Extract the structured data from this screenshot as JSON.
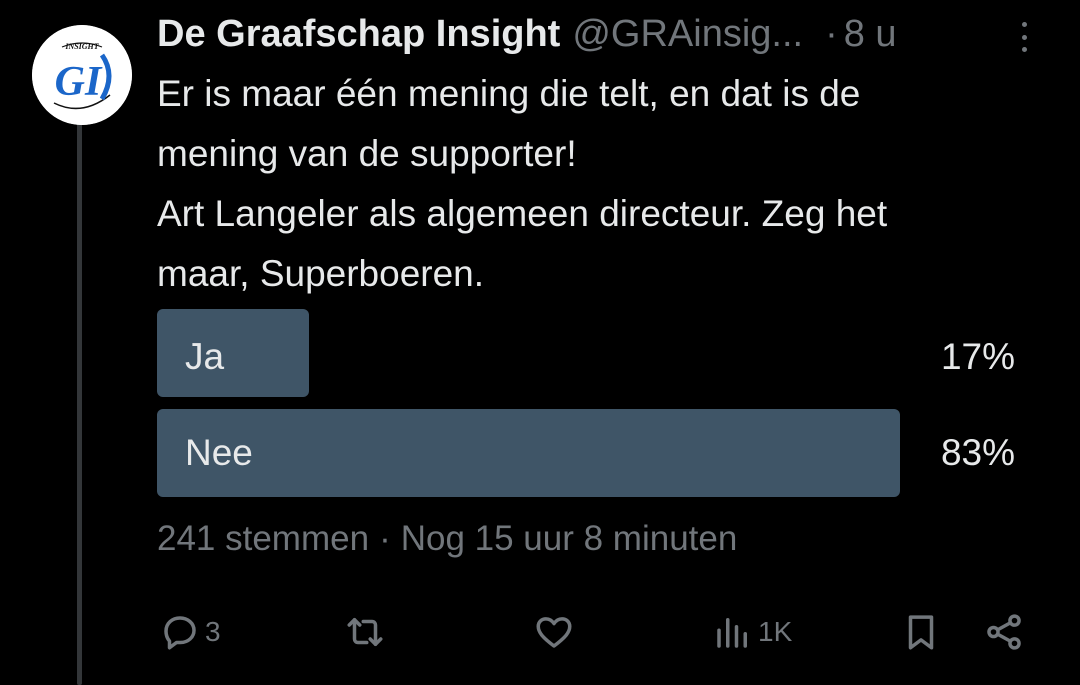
{
  "author": {
    "display_name": "De Graafschap Insight",
    "handle": "@GRAinsig...",
    "time_separator": "·",
    "time": "8 u",
    "avatar": {
      "icon": "gi-logo",
      "text": "GI",
      "caption": "INSIGHT"
    }
  },
  "tweet": {
    "lines": [
      "Er is maar één mening die telt, en dat is de",
      "mening van de supporter!",
      "Art Langeler als algemeen directeur. Zeg het",
      "maar, Superboeren."
    ]
  },
  "poll": {
    "options": [
      {
        "label": "Ja",
        "percent_text": "17%",
        "fraction": 0.17
      },
      {
        "label": "Nee",
        "percent_text": "83%",
        "fraction": 0.83
      }
    ],
    "votes": "241 stemmen",
    "separator": "·",
    "remaining": "Nog 15 uur 8 minuten",
    "bar_color": "#3f5567"
  },
  "actions": {
    "reply": {
      "icon": "reply-icon",
      "count": "3"
    },
    "retweet": {
      "icon": "retweet-icon",
      "count": ""
    },
    "like": {
      "icon": "heart-icon",
      "count": ""
    },
    "views": {
      "icon": "views-icon",
      "count": "1K"
    },
    "bookmark": {
      "icon": "bookmark-icon"
    },
    "share": {
      "icon": "share-icon"
    }
  },
  "colors": {
    "background": "#000000",
    "text_primary": "#e7e9ea",
    "text_secondary": "#71767b",
    "logo_blue": "#1b66c9"
  }
}
